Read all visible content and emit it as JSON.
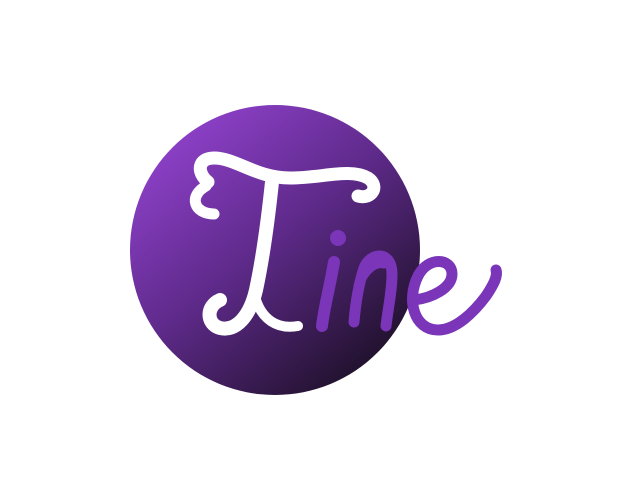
{
  "logo": {
    "wordmark": "Tine",
    "colors": {
      "circle_light": "#8a3fc4",
      "circle_dark": "#1d1028",
      "letter_T": "#ffffff",
      "letters_ine": "#7a35b8",
      "background": "#ffffff"
    }
  }
}
